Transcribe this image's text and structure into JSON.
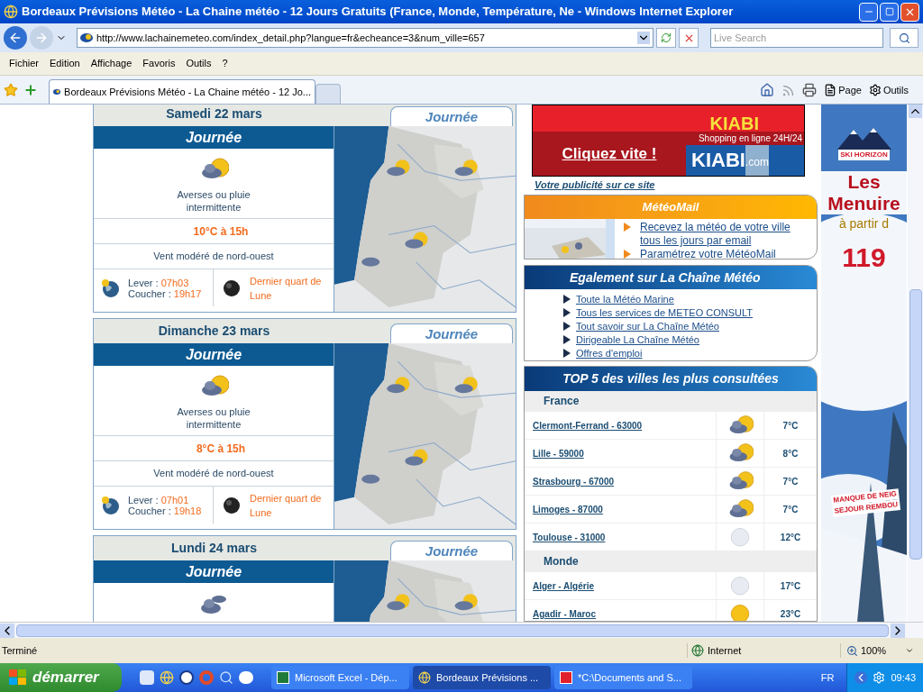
{
  "window": {
    "title": "Bordeaux Prévisions Météo - La Chaine météo - 12 Jours Gratuits (France, Monde, Température, Ne - Windows Internet Explorer"
  },
  "address": {
    "url": "http://www.lachainemeteo.com/index_detail.php?langue=fr&echeance=3&num_ville=657"
  },
  "search": {
    "placeholder": "Live Search"
  },
  "menu": [
    "Fichier",
    "Edition",
    "Affichage",
    "Favoris",
    "Outils",
    "?"
  ],
  "tabs": [
    {
      "label": "Bordeaux Prévisions Météo - La Chaine météo - 12 Jo...",
      "selected": true
    }
  ],
  "toolbar": {
    "page": "Page",
    "tools": "Outils"
  },
  "days": [
    {
      "date": "Samedi 22 mars",
      "map_tab": "Journée",
      "period": "Journée",
      "kind": "cloud_sun",
      "description": "Averses ou pluie intermittente",
      "temperature": "10°C à 15h",
      "wind": "Vent modéré de nord-ouest",
      "sunrise_label": "Lever :",
      "sunrise": "07h03",
      "sunset_label": "Coucher :",
      "sunset": "19h17",
      "moon": "Dernier quart de Lune"
    },
    {
      "date": "Dimanche 23 mars",
      "map_tab": "Journée",
      "period": "Journée",
      "kind": "cloud_sun",
      "description": "Averses ou pluie intermittente",
      "temperature": "8°C à 15h",
      "wind": "Vent modéré de nord-ouest",
      "sunrise_label": "Lever :",
      "sunrise": "07h01",
      "sunset_label": "Coucher :",
      "sunset": "19h18",
      "moon": "Dernier quart de Lune"
    },
    {
      "date": "Lundi 24 mars",
      "map_tab": "Journée",
      "period": "Journée",
      "kind": "clouds"
    }
  ],
  "banner": {
    "brand_top": "KIABI",
    "tagline": "Shopping en ligne 24H/24",
    "cta": "Cliquez vite !",
    "brand": "KIABI",
    "brand_suffix": ".com"
  },
  "ad_link": "Votre publicité sur ce site",
  "meteomail": {
    "title": "MétéoMail",
    "links": [
      "Recevez la météo de votre ville tous les jours par email",
      "Paramétrez votre MétéoMail"
    ]
  },
  "also": {
    "title": "Egalement sur La Chaîne Météo",
    "links": [
      "Toute la Météo Marine",
      "Tous les services de METEO CONSULT",
      "Tout savoir sur La Chaîne Météo",
      "Dirigeable La Chaîne Météo",
      "Offres d'emploi"
    ]
  },
  "top5": {
    "title": "TOP 5 des villes les plus consultées",
    "sections": [
      {
        "name": "France",
        "rows": [
          {
            "city": "Clermont-Ferrand - 63000",
            "kind": "cloud_sun",
            "temp": "7°C"
          },
          {
            "city": "Lille - 59000",
            "kind": "cloud_sun",
            "temp": "8°C"
          },
          {
            "city": "Strasbourg - 67000",
            "kind": "cloud_sun",
            "temp": "7°C"
          },
          {
            "city": "Limoges - 87000",
            "kind": "cloud_sun",
            "temp": "7°C"
          },
          {
            "city": "Toulouse - 31000",
            "kind": "veiled_sun",
            "temp": "12°C"
          }
        ]
      },
      {
        "name": "Monde",
        "rows": [
          {
            "city": "Alger - Algérie",
            "kind": "veiled_sun",
            "temp": "17°C"
          },
          {
            "city": "Agadir - Maroc",
            "kind": "sun",
            "temp": "23°C"
          }
        ]
      }
    ]
  },
  "skyscraper": {
    "brand": "SKI HORIZON",
    "headline": "Les Menuire",
    "sub": "à partir d",
    "price": "119",
    "footer": [
      "MANQUE DE NEIG",
      "SEJOUR REMBOU"
    ]
  },
  "status_bar": {
    "text": "Terminé",
    "zone": "Internet",
    "zoom": "100%"
  },
  "taskbar": {
    "start": "démarrer",
    "tasks": [
      {
        "label": "Microsoft Excel - Dép...",
        "kind": "excel",
        "selected": false
      },
      {
        "label": "Bordeaux Prévisions ...",
        "kind": "ie",
        "selected": true
      },
      {
        "label": "*C:\\Documents and S...",
        "kind": "paint",
        "selected": false
      }
    ],
    "lang": "FR",
    "clock": "09:43"
  }
}
